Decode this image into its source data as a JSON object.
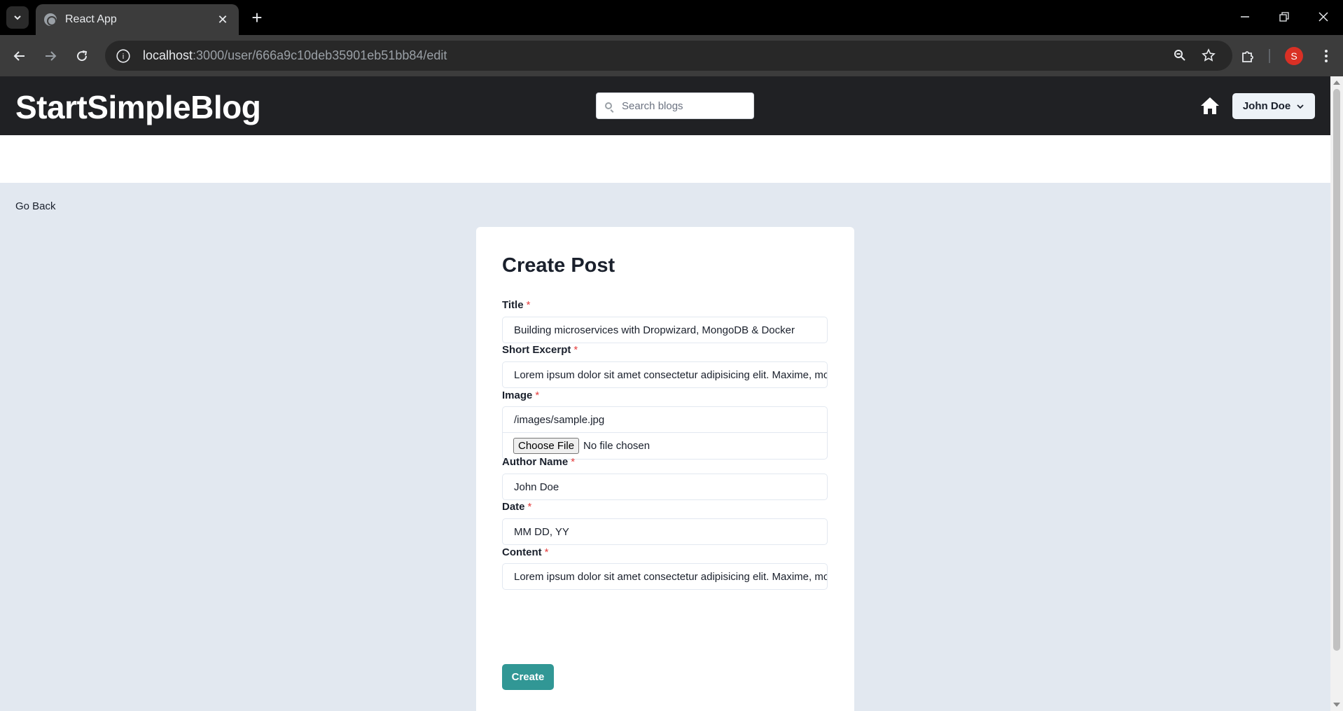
{
  "browser": {
    "tab_title": "React App",
    "url_host": "localhost",
    "url_path": ":3000/user/666a9c10deb35901eb51bb84/edit",
    "profile_initial": "S"
  },
  "header": {
    "logo": "StartSimpleBlog",
    "search_placeholder": "Search blogs",
    "user_menu_label": "John Doe"
  },
  "nav": {
    "go_back": "Go Back"
  },
  "form": {
    "title": "Create Post",
    "required_mark": "*",
    "fields": [
      {
        "label": "Title",
        "value": "Building microservices with Dropwizard, MongoDB & Docker"
      },
      {
        "label": "Short Excerpt",
        "value": "Lorem ipsum dolor sit amet consectetur adipisicing elit. Maxime, mollitia"
      },
      {
        "label": "Image",
        "value": "/images/sample.jpg"
      },
      {
        "label": "Author Name",
        "value": "John Doe"
      },
      {
        "label": "Date",
        "value": "MM DD, YY"
      },
      {
        "label": "Content",
        "value": "Lorem ipsum dolor sit amet consectetur adipisicing elit. Maxime, mollitia"
      }
    ],
    "file_button": "Choose File",
    "file_status": "No file chosen",
    "submit_label": "Create"
  },
  "colors": {
    "header_bg": "#202124",
    "page_bg": "#e2e8f0",
    "accent": "#319795",
    "required": "#e53e3e"
  }
}
